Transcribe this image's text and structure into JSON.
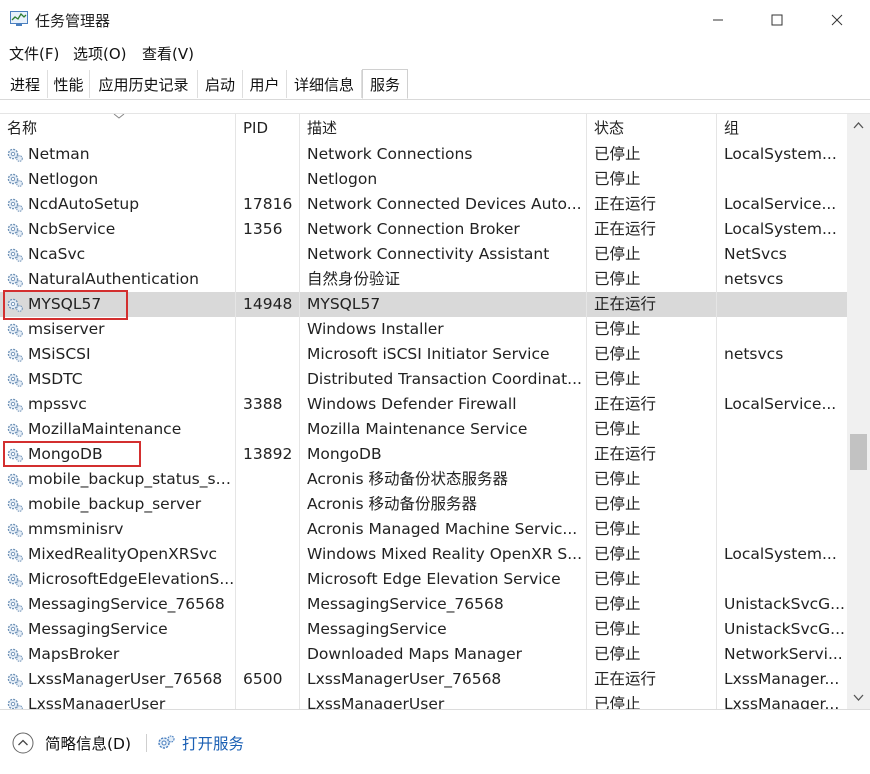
{
  "window": {
    "title": "任务管理器",
    "icon": "task-manager-icon",
    "controls": [
      "minimize-icon",
      "maximize-icon",
      "close-icon"
    ]
  },
  "menu": [
    "文件(F)",
    "选项(O)",
    "查看(V)"
  ],
  "tabs": [
    "进程",
    "性能",
    "应用历史记录",
    "启动",
    "用户",
    "详细信息",
    "服务"
  ],
  "active_tab": "服务",
  "columns": [
    "名称",
    "PID",
    "描述",
    "状态",
    "组"
  ],
  "rows": [
    {
      "name": "Netman",
      "pid": "",
      "desc": "Network Connections",
      "status": "已停止",
      "group": "LocalSystem..."
    },
    {
      "name": "Netlogon",
      "pid": "",
      "desc": "Netlogon",
      "status": "已停止",
      "group": ""
    },
    {
      "name": "NcdAutoSetup",
      "pid": "17816",
      "desc": "Network Connected Devices Auto...",
      "status": "正在运行",
      "group": "LocalService..."
    },
    {
      "name": "NcbService",
      "pid": "1356",
      "desc": "Network Connection Broker",
      "status": "正在运行",
      "group": "LocalSystem..."
    },
    {
      "name": "NcaSvc",
      "pid": "",
      "desc": "Network Connectivity Assistant",
      "status": "已停止",
      "group": "NetSvcs"
    },
    {
      "name": "NaturalAuthentication",
      "pid": "",
      "desc": "自然身份验证",
      "status": "已停止",
      "group": "netsvcs"
    },
    {
      "name": "MYSQL57",
      "pid": "14948",
      "desc": "MYSQL57",
      "status": "正在运行",
      "group": ""
    },
    {
      "name": "msiserver",
      "pid": "",
      "desc": "Windows Installer",
      "status": "已停止",
      "group": ""
    },
    {
      "name": "MSiSCSI",
      "pid": "",
      "desc": "Microsoft iSCSI Initiator Service",
      "status": "已停止",
      "group": "netsvcs"
    },
    {
      "name": "MSDTC",
      "pid": "",
      "desc": "Distributed Transaction Coordinat...",
      "status": "已停止",
      "group": ""
    },
    {
      "name": "mpssvc",
      "pid": "3388",
      "desc": "Windows Defender Firewall",
      "status": "正在运行",
      "group": "LocalService..."
    },
    {
      "name": "MozillaMaintenance",
      "pid": "",
      "desc": "Mozilla Maintenance Service",
      "status": "已停止",
      "group": ""
    },
    {
      "name": "MongoDB",
      "pid": "13892",
      "desc": "MongoDB",
      "status": "正在运行",
      "group": ""
    },
    {
      "name": "mobile_backup_status_se...",
      "pid": "",
      "desc": "Acronis 移动备份状态服务器",
      "status": "已停止",
      "group": ""
    },
    {
      "name": "mobile_backup_server",
      "pid": "",
      "desc": "Acronis 移动备份服务器",
      "status": "已停止",
      "group": ""
    },
    {
      "name": "mmsminisrv",
      "pid": "",
      "desc": "Acronis Managed Machine Servic...",
      "status": "已停止",
      "group": ""
    },
    {
      "name": "MixedRealityOpenXRSvc",
      "pid": "",
      "desc": "Windows Mixed Reality OpenXR S...",
      "status": "已停止",
      "group": "LocalSystem..."
    },
    {
      "name": "MicrosoftEdgeElevationS...",
      "pid": "",
      "desc": "Microsoft Edge Elevation Service",
      "status": "已停止",
      "group": ""
    },
    {
      "name": "MessagingService_76568",
      "pid": "",
      "desc": "MessagingService_76568",
      "status": "已停止",
      "group": "UnistackSvcG..."
    },
    {
      "name": "MessagingService",
      "pid": "",
      "desc": "MessagingService",
      "status": "已停止",
      "group": "UnistackSvcG..."
    },
    {
      "name": "MapsBroker",
      "pid": "",
      "desc": "Downloaded Maps Manager",
      "status": "已停止",
      "group": "NetworkServi..."
    },
    {
      "name": "LxssManagerUser_76568",
      "pid": "6500",
      "desc": "LxssManagerUser_76568",
      "status": "正在运行",
      "group": "LxssManager..."
    },
    {
      "name": "LxssManagerUser",
      "pid": "",
      "desc": "LxssManagerUser",
      "status": "已停止",
      "group": "LxssManager..."
    }
  ],
  "selected_row": "MYSQL57",
  "highlighted_rows": [
    "MYSQL57",
    "MongoDB"
  ],
  "footer": {
    "brief": "简略信息(D)",
    "open_services": "打开服务"
  },
  "colors": {
    "selected_row": "#d9d9d9",
    "highlight_border": "#d32f2f",
    "link": "#1a5fb4"
  }
}
